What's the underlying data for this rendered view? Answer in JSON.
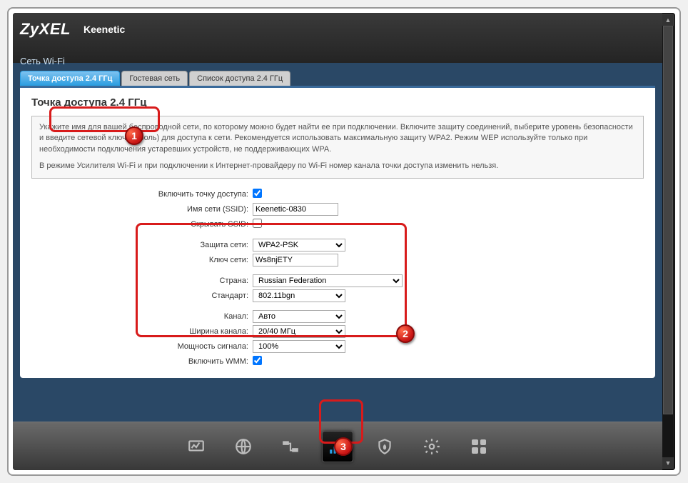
{
  "logo": "ZyXEL",
  "model": "Keenetic",
  "section": "Сеть Wi-Fi",
  "tabs": [
    {
      "label": "Точка доступа 2.4 ГГц",
      "active": true
    },
    {
      "label": "Гостевая сеть",
      "active": false
    },
    {
      "label": "Список доступа 2.4 ГГц",
      "active": false
    }
  ],
  "panel_title": "Точка доступа 2.4 ГГц",
  "desc1": "Укажите имя для вашей беспроводной сети, по которому можно будет найти ее при подключении. Включите защиту соединений, выберите уровень безопасности и введите сетевой ключ (пароль) для доступа к сети. Рекомендуется использовать максимальную защиту WPA2. Режим WEP используйте только при необходимости подключения устаревших устройств, не поддерживающих WPA.",
  "desc2": "В режиме Усилителя Wi-Fi и при подключении к Интернет-провайдеру по Wi-Fi номер канала точки доступа изменить нельзя.",
  "form": {
    "enable_ap_label": "Включить точку доступа:",
    "enable_ap": true,
    "ssid_label": "Имя сети (SSID):",
    "ssid": "Keenetic-0830",
    "hide_ssid_label": "Скрывать SSID:",
    "hide_ssid": false,
    "security_label": "Защита сети:",
    "security": "WPA2-PSK",
    "key_label": "Ключ сети:",
    "key": "Ws8njETY",
    "country_label": "Страна:",
    "country": "Russian Federation",
    "standard_label": "Стандарт:",
    "standard": "802.11bgn",
    "channel_label": "Канал:",
    "channel": "Авто",
    "width_label": "Ширина канала:",
    "width": "20/40 МГц",
    "power_label": "Мощность сигнала:",
    "power": "100%",
    "wmm_label": "Включить WMM:",
    "wmm": true
  },
  "badges": {
    "b1": "1",
    "b2": "2",
    "b3": "3"
  }
}
